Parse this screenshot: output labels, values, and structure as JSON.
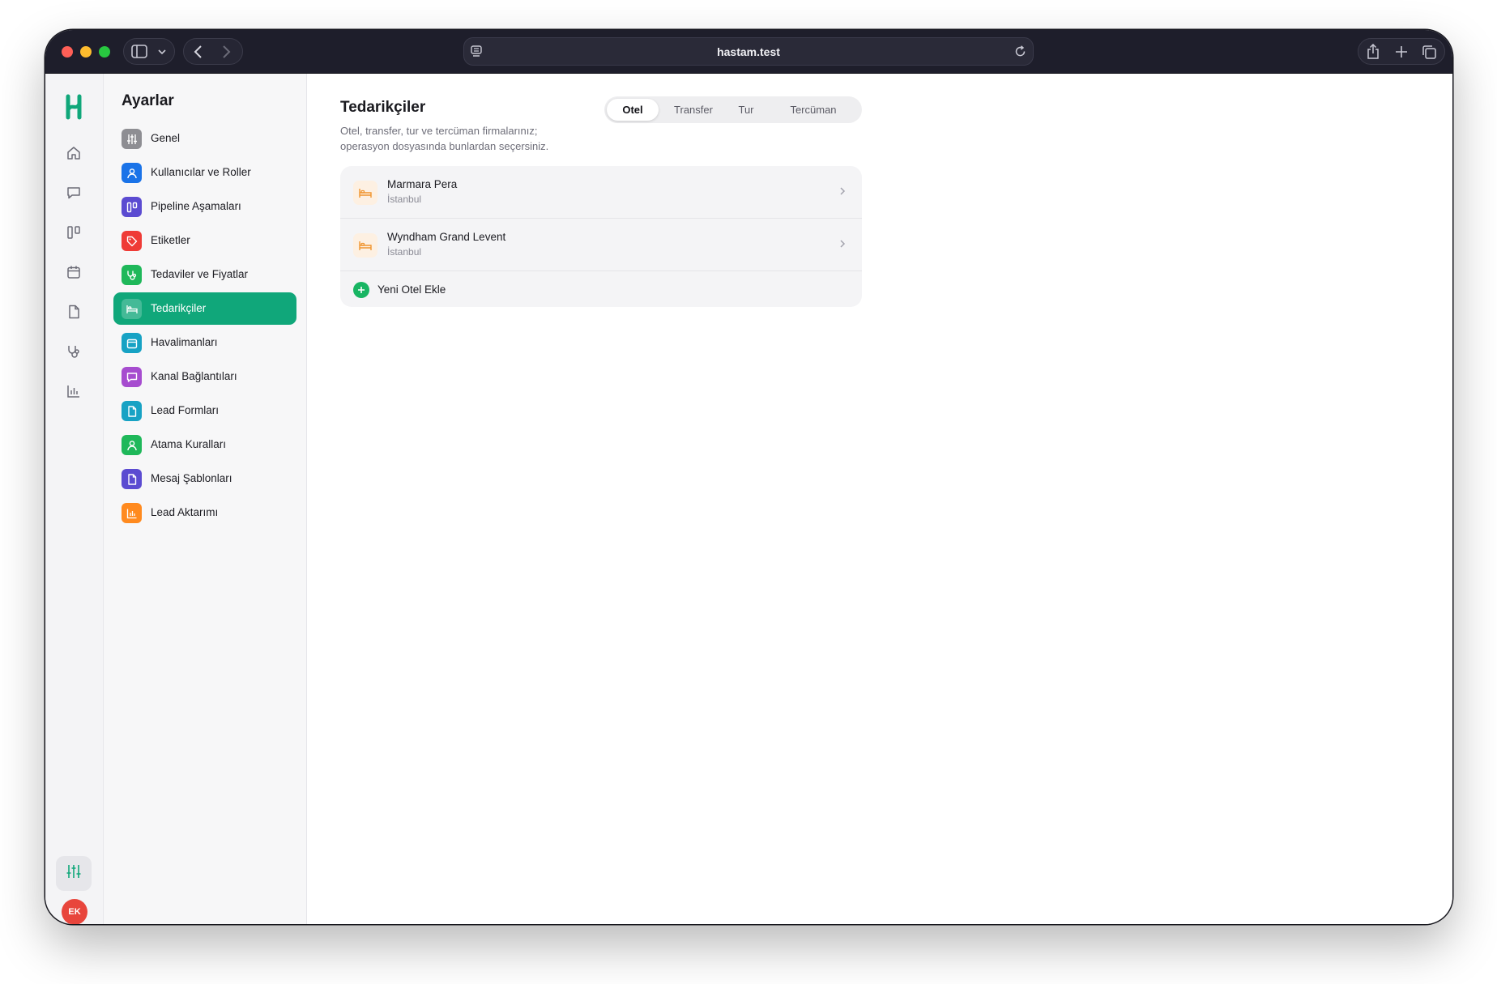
{
  "browser": {
    "url": "hastam.test"
  },
  "settings": {
    "title": "Ayarlar",
    "items": [
      {
        "label": "Genel",
        "color": "#8e8e93",
        "icon": "sliders-icon"
      },
      {
        "label": "Kullanıcılar ve Roller",
        "color": "#1a73e8",
        "icon": "user-icon"
      },
      {
        "label": "Pipeline Aşamaları",
        "color": "#5b4bd1",
        "icon": "kanban-icon"
      },
      {
        "label": "Etiketler",
        "color": "#ef3b36",
        "icon": "tag-icon"
      },
      {
        "label": "Tedaviler ve Fiyatlar",
        "color": "#1fb85a",
        "icon": "stethoscope-icon"
      },
      {
        "label": "Tedarikçiler",
        "color": "#10a77a",
        "icon": "bed-icon",
        "active": true
      },
      {
        "label": "Havalimanları",
        "color": "#17a2c4",
        "icon": "calendar-icon"
      },
      {
        "label": "Kanal Bağlantıları",
        "color": "#a64ccf",
        "icon": "message-icon"
      },
      {
        "label": "Lead Formları",
        "color": "#17a2c4",
        "icon": "file-icon"
      },
      {
        "label": "Atama Kuralları",
        "color": "#1fb85a",
        "icon": "user-icon"
      },
      {
        "label": "Mesaj Şablonları",
        "color": "#5b4bd1",
        "icon": "file-icon"
      },
      {
        "label": "Lead Aktarımı",
        "color": "#ff8a1f",
        "icon": "chart-icon"
      }
    ]
  },
  "user": {
    "initials": "EK"
  },
  "page": {
    "title": "Tedarikçiler",
    "description": "Otel, transfer, tur ve tercüman firmalarınız; operasyon dosyasında bunlardan seçersiniz.",
    "tabs": [
      {
        "label": "Otel",
        "active": true
      },
      {
        "label": "Transfer"
      },
      {
        "label": "Tur"
      },
      {
        "label": "Tercüman"
      }
    ],
    "hotels": [
      {
        "name": "Marmara Pera",
        "city": "İstanbul"
      },
      {
        "name": "Wyndham Grand Levent",
        "city": "İstanbul"
      }
    ],
    "add_label": "Yeni Otel Ekle"
  },
  "colors": {
    "accent": "#10a77a",
    "hotel_icon": "#f0942e",
    "add_button": "#18b563"
  }
}
